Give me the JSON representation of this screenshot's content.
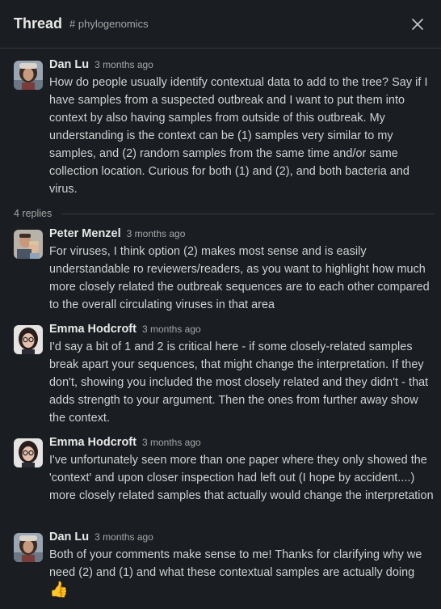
{
  "header": {
    "title": "Thread",
    "channel": "# phylogenomics",
    "close_icon": "close-icon"
  },
  "replies_label": "4 replies",
  "messages": [
    {
      "author": "Dan Lu",
      "time": "3 months ago",
      "text": "How do people usually identify contextual data to add to the tree? Say if I have samples from a suspected outbreak and I want to put them into context by also having samples from outside of this outbreak. My understanding is the context can be (1) samples very similar to my samples, and (2) random samples from the same time and/or same collection location. Curious for both (1) and (2), and both bacteria and virus."
    },
    {
      "author": "Peter Menzel",
      "time": "3 months ago",
      "text": "For viruses, I think option (2) makes most sense and is easily understandable ro reviewers/readers, as you want to highlight how much more closely related the outbreak sequences are to each other compared to the overall circulating viruses in that area"
    },
    {
      "author": "Emma Hodcroft",
      "time": "3 months ago",
      "text": "I'd say a bit of 1 and 2 is critical here - if some closely-related samples break apart your sequences, that might change the interpretation. If they don't, showing you included the most closely related and they didn't - that adds strength to your argument. Then the ones from further away show the context."
    },
    {
      "author": "Emma Hodcroft",
      "time": "3 months ago",
      "text": "I've unfortunately seen more than one paper where they only showed the 'context' and upon closer inspection had left out (I hope by accident....) more closely related samples that actually would change the interpretation"
    },
    {
      "author": "Dan Lu",
      "time": "3 months ago",
      "text": "Both of your comments make sense to me! Thanks for clarifying why we need (2) and (1) and what these contextual samples are actually doing",
      "emoji": "👍"
    }
  ]
}
